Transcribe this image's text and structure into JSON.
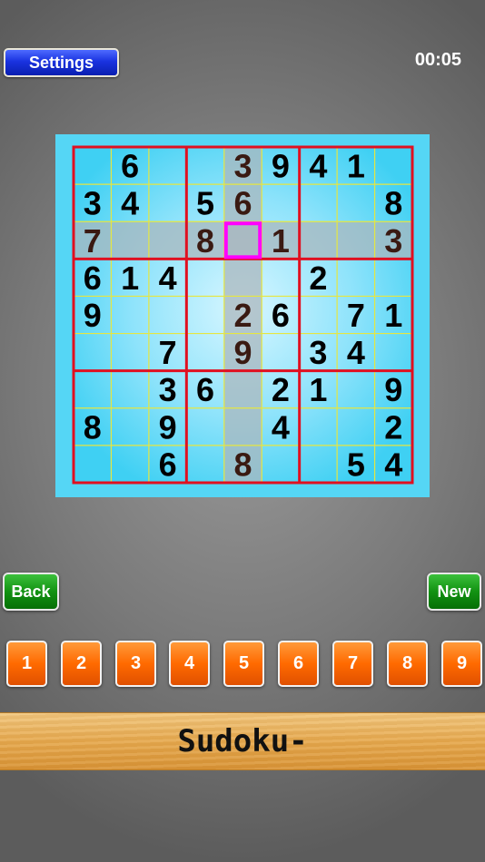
{
  "header": {
    "settings_label": "Settings",
    "timer": "00:05"
  },
  "board": {
    "selected": [
      2,
      4
    ],
    "colors": {
      "given": "#000000",
      "highlight": "#3a1a12",
      "region_border": "#e01020",
      "grid_line": "#e6e640",
      "selection": "#ff00ff",
      "highlight_band": "#a9b7bd"
    },
    "cells": [
      [
        "",
        "6",
        "",
        "",
        "3",
        "9",
        "4",
        "1",
        ""
      ],
      [
        "3",
        "4",
        "",
        "5",
        "6",
        "",
        "",
        "",
        "8"
      ],
      [
        "7",
        "",
        "",
        "8",
        "",
        "1",
        "",
        "",
        "3"
      ],
      [
        "6",
        "1",
        "4",
        "",
        "",
        "",
        "2",
        "",
        ""
      ],
      [
        "9",
        "",
        "",
        "",
        "2",
        "6",
        "",
        "7",
        "1"
      ],
      [
        "",
        "",
        "7",
        "",
        "9",
        "",
        "3",
        "4",
        ""
      ],
      [
        "",
        "",
        "3",
        "6",
        "",
        "2",
        "1",
        "",
        "9"
      ],
      [
        "8",
        "",
        "9",
        "",
        "",
        "4",
        "",
        "",
        "2"
      ],
      [
        "",
        "",
        "6",
        "",
        "8",
        "",
        "",
        "5",
        "4"
      ]
    ]
  },
  "controls": {
    "back_label": "Back",
    "new_label": "New"
  },
  "numbers": [
    "1",
    "2",
    "3",
    "4",
    "5",
    "6",
    "7",
    "8",
    "9"
  ],
  "banner": {
    "title": "Sudoku-"
  }
}
